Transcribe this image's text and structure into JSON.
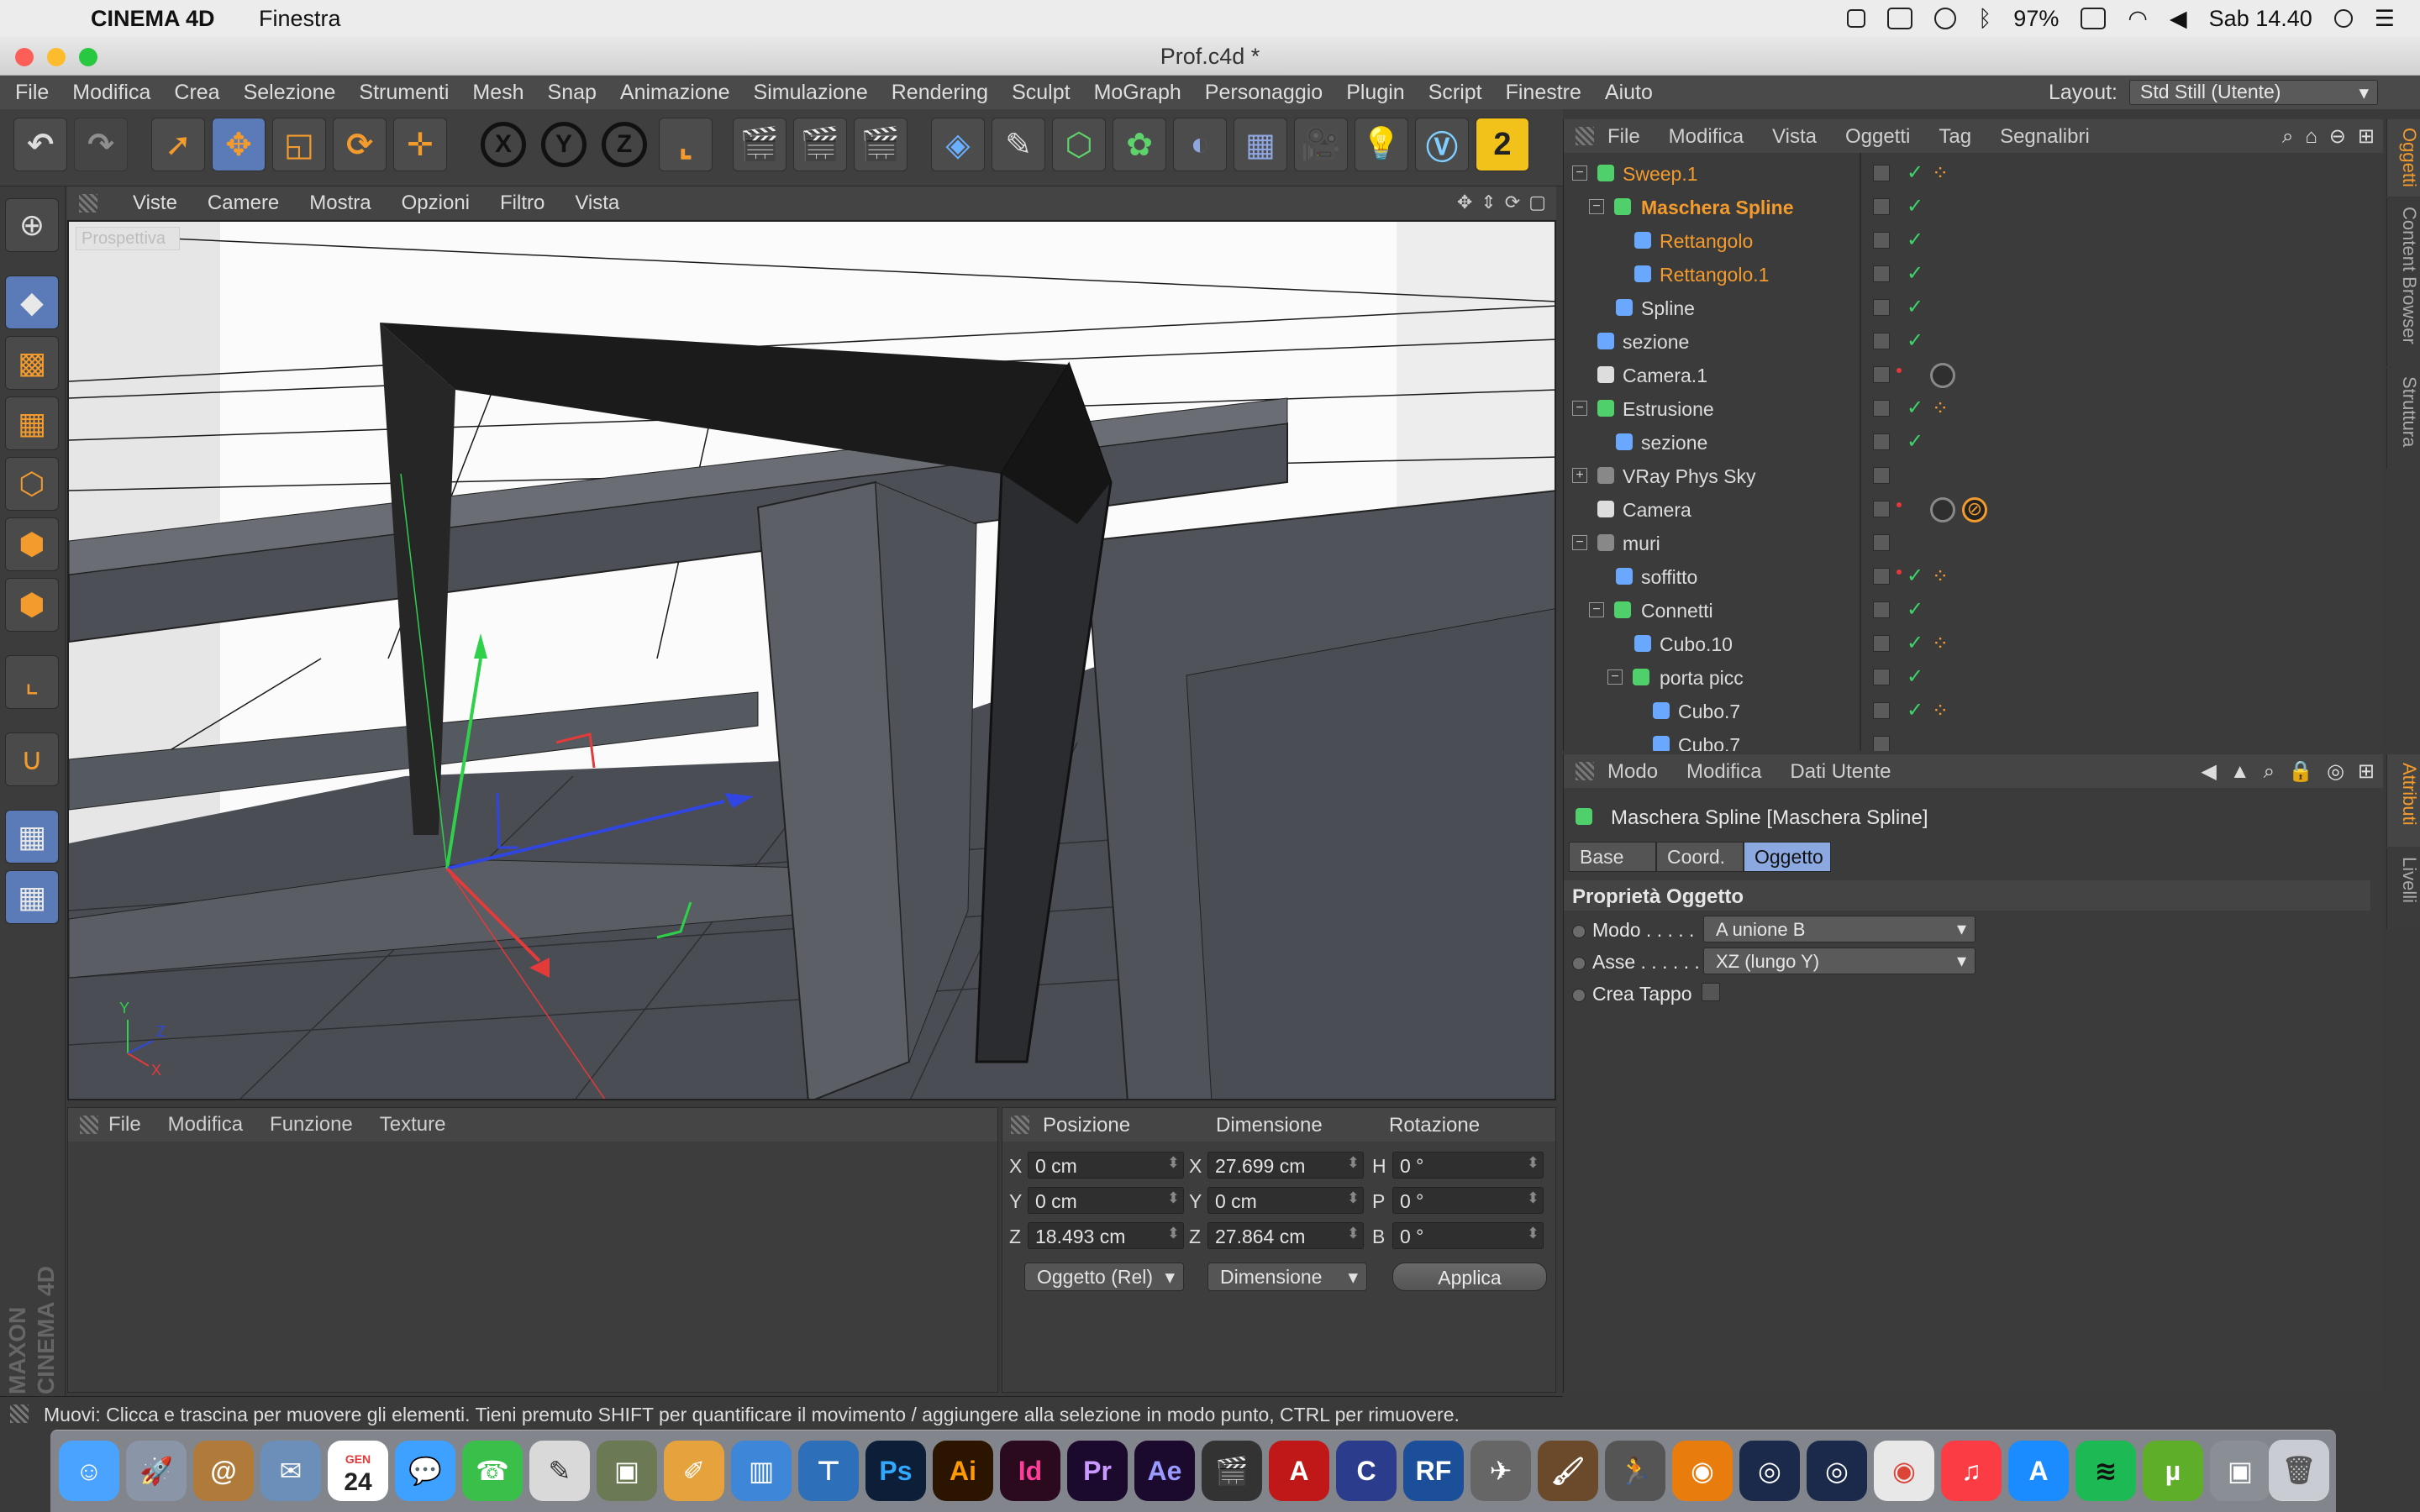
{
  "menubar": {
    "app_name": "CINEMA 4D",
    "menu": "Finestra",
    "battery": "97%",
    "clock": "Sab 14.40"
  },
  "window": {
    "title": "Prof.c4d *"
  },
  "app_menu": {
    "items": [
      "File",
      "Modifica",
      "Crea",
      "Selezione",
      "Strumenti",
      "Mesh",
      "Snap",
      "Animazione",
      "Simulazione",
      "Rendering",
      "Sculpt",
      "MoGraph",
      "Personaggio",
      "Plugin",
      "Script",
      "Finestre",
      "Aiuto"
    ],
    "layout_label": "Layout:",
    "layout_value": "Std Still (Utente)"
  },
  "toolbar": {
    "x": "X",
    "y": "Y",
    "z": "Z",
    "mesh_badge": "2"
  },
  "viewport": {
    "menu": [
      "Viste",
      "Camere",
      "Mostra",
      "Opzioni",
      "Filtro",
      "Vista"
    ],
    "label": "Prospettiva",
    "axis_y": "Y",
    "axis_z": "Z",
    "axis_x": "X",
    "colors": {
      "x_axis": "#e33a3a",
      "y_axis": "#2fd04a",
      "z_axis": "#3146e0"
    }
  },
  "materials": {
    "menu": [
      "File",
      "Modifica",
      "Funzione",
      "Texture"
    ]
  },
  "coords": {
    "headers": [
      "Posizione",
      "Dimensione",
      "Rotazione"
    ],
    "rows": [
      {
        "l1": "X",
        "pos": "0 cm",
        "l2": "X",
        "dim": "27.699 cm",
        "l3": "H",
        "rot": "0 °"
      },
      {
        "l1": "Y",
        "pos": "0 cm",
        "l2": "Y",
        "dim": "0 cm",
        "l3": "P",
        "rot": "0 °"
      },
      {
        "l1": "Z",
        "pos": "18.493 cm",
        "l2": "Z",
        "dim": "27.864 cm",
        "l3": "B",
        "rot": "0 °"
      }
    ],
    "mode_drop": "Oggetto (Rel)",
    "size_drop": "Dimensione",
    "apply": "Applica"
  },
  "status": "Muovi: Clicca e trascina per muovere gli elementi. Tieni premuto SHIFT per quantificare il movimento / aggiungere alla selezione in modo punto, CTRL per rimuovere.",
  "object_manager": {
    "menu": [
      "File",
      "Modifica",
      "Vista",
      "Oggetti",
      "Tag",
      "Segnalibri"
    ],
    "rows": [
      {
        "name": "Sweep.1",
        "style": "sel"
      },
      {
        "name": "Maschera Spline",
        "style": "selb"
      },
      {
        "name": "Rettangolo",
        "style": "sel"
      },
      {
        "name": "Rettangolo.1",
        "style": "sel"
      },
      {
        "name": "Spline",
        "style": ""
      },
      {
        "name": "sezione",
        "style": ""
      },
      {
        "name": "Camera.1",
        "style": ""
      },
      {
        "name": "Estrusione",
        "style": ""
      },
      {
        "name": "sezione",
        "style": ""
      },
      {
        "name": "VRay Phys Sky",
        "style": ""
      },
      {
        "name": "Camera",
        "style": ""
      },
      {
        "name": "muri",
        "style": ""
      },
      {
        "name": "soffitto",
        "style": ""
      },
      {
        "name": "Connetti",
        "style": ""
      },
      {
        "name": "Cubo.10",
        "style": ""
      },
      {
        "name": "porta picc",
        "style": ""
      },
      {
        "name": "Cubo.7",
        "style": ""
      },
      {
        "name": "Cubo.7",
        "style": ""
      }
    ],
    "tabs": [
      "Oggetti",
      "Content Browser",
      "Struttura"
    ]
  },
  "attributes": {
    "menu": [
      "Modo",
      "Modifica",
      "Dati Utente"
    ],
    "title": "Maschera Spline [Maschera Spline]",
    "tabs": [
      "Base",
      "Coord.",
      "Oggetto"
    ],
    "section": "Proprietà Oggetto",
    "modo_label": "Modo . . . . .",
    "modo_value": "A unione B",
    "asse_label": "Asse . . . . . .",
    "asse_value": "XZ (lungo Y)",
    "tappo_label": "Crea Tappo",
    "side_tabs": [
      "Attributi",
      "Livelli"
    ]
  },
  "dock": {
    "calendar_month": "GEN",
    "calendar_day": "24",
    "ps": "Ps",
    "ai": "Ai",
    "id": "Id",
    "pr": "Pr",
    "ae": "Ae",
    "rf": "RF"
  },
  "maxon": {
    "line1": "MAXON",
    "line2": "CINEMA 4D"
  }
}
